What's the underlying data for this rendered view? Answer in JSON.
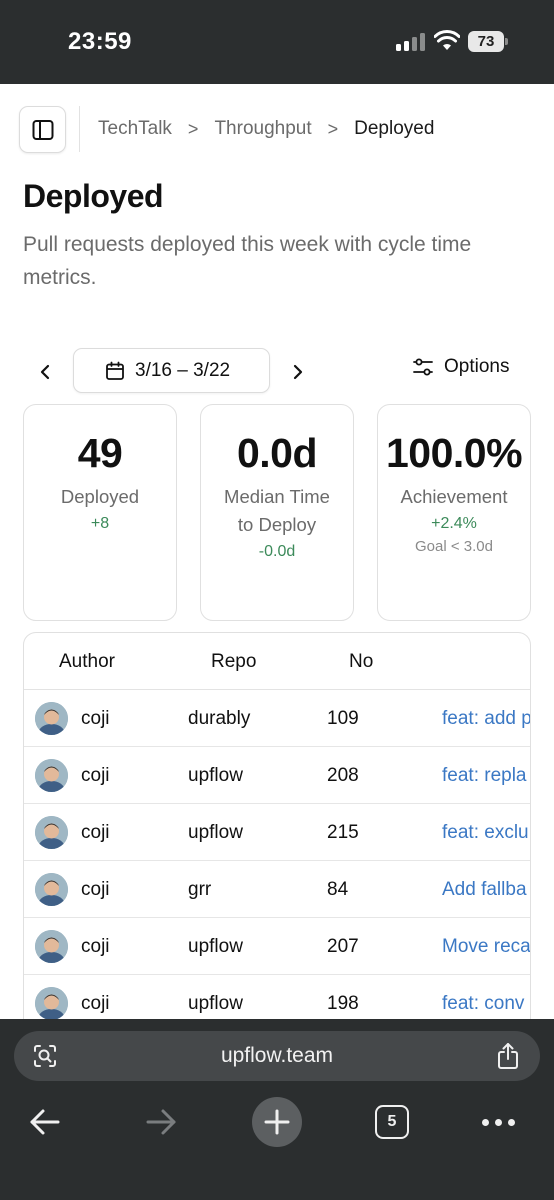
{
  "status_bar": {
    "time": "23:59",
    "battery": "73"
  },
  "header": {
    "breadcrumb": [
      "TechTalk",
      "Throughput",
      "Deployed"
    ],
    "separator": ">"
  },
  "page": {
    "title": "Deployed",
    "description": "Pull requests deployed this week with cycle time metrics."
  },
  "toolbar": {
    "date_range": "3/16 – 3/22",
    "options_label": "Options"
  },
  "stats": [
    {
      "value": "49",
      "label": "Deployed",
      "delta": "+8",
      "goal": ""
    },
    {
      "value": "0.0d",
      "label": "Median Time to Deploy",
      "delta": "-0.0d",
      "goal": ""
    },
    {
      "value": "100.0%",
      "label": "Achievement",
      "delta": "+2.4%",
      "goal": "Goal < 3.0d"
    }
  ],
  "table": {
    "columns": [
      "Author",
      "Repo",
      "No"
    ],
    "rows": [
      {
        "author": "coji",
        "repo": "durably",
        "no": "109",
        "title": "feat: add p"
      },
      {
        "author": "coji",
        "repo": "upflow",
        "no": "208",
        "title": "feat: repla"
      },
      {
        "author": "coji",
        "repo": "upflow",
        "no": "215",
        "title": "feat: exclu"
      },
      {
        "author": "coji",
        "repo": "grr",
        "no": "84",
        "title": "Add fallba"
      },
      {
        "author": "coji",
        "repo": "upflow",
        "no": "207",
        "title": "Move reca"
      },
      {
        "author": "coji",
        "repo": "upflow",
        "no": "198",
        "title": "feat: conv"
      }
    ]
  },
  "browser": {
    "url": "upflow.team",
    "tab_count": "5"
  },
  "colors": {
    "delta_positive": "#3c8a5a",
    "link": "#3b78c4",
    "chrome": "#2b2e2f"
  }
}
